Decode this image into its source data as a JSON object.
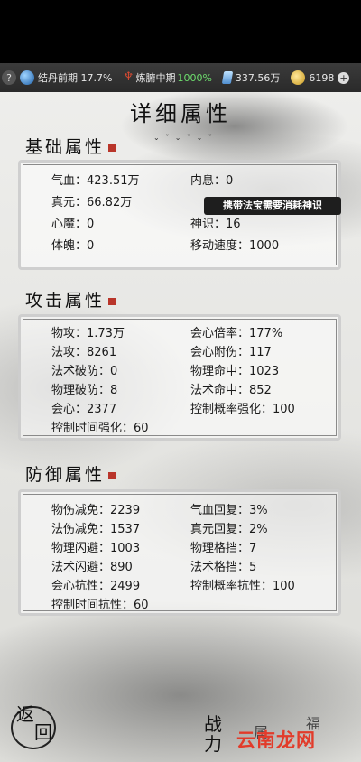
{
  "resources": {
    "help": "?",
    "realm_label": "结丹前期",
    "realm_pct": "17.7%",
    "body_label": "炼腑中期",
    "body_pct": "1000%",
    "spirit_stones": "337.56万",
    "coins": "6198",
    "plus": "+"
  },
  "title": "详细属性",
  "sections": {
    "basic": {
      "title": "基础属性",
      "rows": [
        [
          {
            "text": "气血：423.51万"
          },
          {
            "text": "内息：0"
          }
        ],
        [
          {
            "text": "真元：66.82万"
          },
          {
            "text": ""
          }
        ],
        [
          {
            "text": "心魔：0"
          },
          {
            "text": "神识：16"
          }
        ],
        [
          {
            "text": "体魄：0"
          },
          {
            "text": "移动速度：1000"
          }
        ]
      ],
      "tooltip": "携带法宝需要消耗神识"
    },
    "attack": {
      "title": "攻击属性",
      "rows": [
        [
          {
            "text": "物攻：1.73万"
          },
          {
            "text": "会心倍率：177%"
          }
        ],
        [
          {
            "text": "法攻：8261"
          },
          {
            "text": "会心附伤：117"
          }
        ],
        [
          {
            "text": "法术破防：0"
          },
          {
            "text": "物理命中：1023"
          }
        ],
        [
          {
            "text": "物理破防：8"
          },
          {
            "text": "法术命中：852"
          }
        ],
        [
          {
            "text": "会心：2377"
          },
          {
            "text": "控制概率强化：100"
          }
        ],
        [
          {
            "text": "控制时间强化：60"
          },
          {
            "text": ""
          }
        ]
      ]
    },
    "defense": {
      "title": "防御属性",
      "rows": [
        [
          {
            "text": "物伤减免：2239"
          },
          {
            "text": "气血回复：3%"
          }
        ],
        [
          {
            "text": "法伤减免：1537"
          },
          {
            "text": "真元回复：2%"
          }
        ],
        [
          {
            "text": "物理闪避：1003"
          },
          {
            "text": "物理格挡：7"
          }
        ],
        [
          {
            "text": "法术闪避：890"
          },
          {
            "text": "法术格挡：5"
          }
        ],
        [
          {
            "text": "会心抗性：2499"
          },
          {
            "text": "控制概率抗性：100"
          }
        ],
        [
          {
            "text": "控制时间抗性：60"
          },
          {
            "text": ""
          }
        ]
      ]
    }
  },
  "bottom": {
    "back_top": "返",
    "back_bottom": "回",
    "battle_top": "战",
    "battle_bottom": "力",
    "char3": "属",
    "char4": "福"
  },
  "watermark": "云南龙网",
  "colors": {
    "accent_green": "#6ddc6d",
    "watermark_red": "#e23b2a",
    "seal_red": "#b9352a"
  }
}
